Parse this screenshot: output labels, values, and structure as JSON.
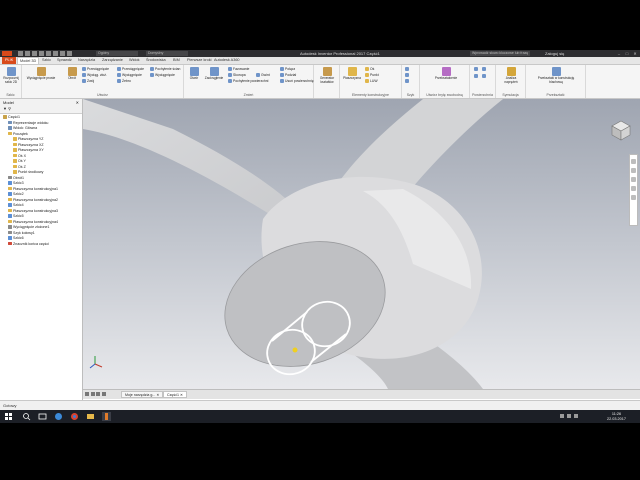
{
  "window": {
    "title": "Autodesk Inventor Professional 2017  Część1",
    "search_placeholder": "Wprowadź słowo kluczowe lub frazę",
    "user": "Zaloguj się",
    "controls": [
      "–",
      "□",
      "✕"
    ]
  },
  "quick_access": {
    "material": "Ogólny",
    "appearance": "Domyślny"
  },
  "tabs": {
    "file": "PLIK",
    "items": [
      "Model 3D",
      "Szkic",
      "Sprawdź",
      "Narzędzia",
      "Zarządzanie",
      "Widok",
      "Środowiska",
      "BIM",
      "Pierwsze kroki",
      "Autodesk A360"
    ]
  },
  "ribbon": {
    "panels": [
      {
        "title": "Szkic",
        "buttons": [
          "Rozpocznij szkic 2D"
        ]
      },
      {
        "title": "Utwórz",
        "buttons": [
          "Wyciągnięcie proste",
          "Obrót"
        ],
        "small": [
          "Przeciągnięcie",
          "Wyciąg. złoż.",
          "Zwój",
          "Przeciągnięcie",
          "Wyciągnięcie",
          "Żebro",
          "Pochylenie ścian",
          "Wyciągnięcie",
          "Powierzchnia",
          "Zaślepka"
        ]
      },
      {
        "title": "Zmień",
        "buttons": [
          "Otwór",
          "Zaokrąglenie"
        ],
        "small": [
          "Fazowanie",
          "Skorupa",
          "Gwint",
          "Pochylenie powierzchni",
          "Połącz",
          "Podział",
          "Usuń",
          "Zamień",
          "Usuń powierzchnię"
        ]
      },
      {
        "title": "Elementy konstrukcyjne",
        "buttons": [
          "Płaszczyzna"
        ],
        "small": [
          "Oś",
          "Punkt",
          "LUW"
        ]
      },
      {
        "title": "Szyk",
        "small": [
          "Szyk",
          "Lustro"
        ]
      },
      {
        "title": "Utwórz bryłę swobodną",
        "buttons": [
          "Przekształcenie"
        ]
      },
      {
        "title": "Powierzchnia",
        "small": [
          "Powierzchnia"
        ]
      },
      {
        "title": "Symulacja",
        "buttons": [
          "Analiza naprężeń"
        ]
      },
      {
        "title": "Przekształć",
        "buttons": [
          "Przekształć w konstrukcję blachową"
        ]
      }
    ],
    "utwórz_dropdown": "Utwórz",
    "zmien_dropdown": "Zmień",
    "gen_ksztaltu": "Generator kształtów",
    "szkic_panel": "Szkic"
  },
  "browser": {
    "title": "Model",
    "close": "✕",
    "tree": [
      {
        "label": "Część1",
        "depth": 0,
        "icon": "#c8a24a"
      },
      {
        "label": "Reprezentacje widoku",
        "depth": 1,
        "icon": "#6f8fb8"
      },
      {
        "label": "Widok: Główna",
        "depth": 1,
        "icon": "#6f8fb8"
      },
      {
        "label": "Początek",
        "depth": 1,
        "icon": "#e0b64a"
      },
      {
        "label": "Płaszczyzna YZ",
        "depth": 2,
        "icon": "#e0b64a"
      },
      {
        "label": "Płaszczyzna XZ",
        "depth": 2,
        "icon": "#e0b64a"
      },
      {
        "label": "Płaszczyzna XY",
        "depth": 2,
        "icon": "#e0b64a"
      },
      {
        "label": "Oś X",
        "depth": 2,
        "icon": "#e0b64a"
      },
      {
        "label": "Oś Y",
        "depth": 2,
        "icon": "#e0b64a"
      },
      {
        "label": "Oś Z",
        "depth": 2,
        "icon": "#e0b64a"
      },
      {
        "label": "Punkt środkowy",
        "depth": 2,
        "icon": "#e0b64a"
      },
      {
        "label": "Obrót1",
        "depth": 1,
        "icon": "#8a8a8a"
      },
      {
        "label": "Szkic3",
        "depth": 1,
        "icon": "#5b8fd6"
      },
      {
        "label": "Płaszczyzna konstrukcyjna1",
        "depth": 1,
        "icon": "#e0b64a"
      },
      {
        "label": "Szkic2",
        "depth": 1,
        "icon": "#5b8fd6"
      },
      {
        "label": "Płaszczyzna konstrukcyjna2",
        "depth": 1,
        "icon": "#e0b64a"
      },
      {
        "label": "Szkic4",
        "depth": 1,
        "icon": "#5b8fd6"
      },
      {
        "label": "Płaszczyzna konstrukcyjna3",
        "depth": 1,
        "icon": "#e0b64a"
      },
      {
        "label": "Szkic5",
        "depth": 1,
        "icon": "#5b8fd6"
      },
      {
        "label": "Płaszczyzna konstrukcyjna4",
        "depth": 1,
        "icon": "#e0b64a"
      },
      {
        "label": "Wyciągnięcie złożone1",
        "depth": 1,
        "icon": "#8a8a8a"
      },
      {
        "label": "Szyk kołowy1",
        "depth": 1,
        "icon": "#8a8a8a"
      },
      {
        "label": "Szkic6",
        "depth": 1,
        "icon": "#5b8fd6"
      },
      {
        "label": "Znacznik końca części",
        "depth": 1,
        "icon": "#d04a3a"
      }
    ]
  },
  "document_tabs": [
    "Moje narzędzia g...",
    "Część1"
  ],
  "doc_tab_close": "✕",
  "status": "Gotowy",
  "taskbar": {
    "time": "11:26",
    "date": "22.03.2017"
  },
  "colors": {
    "accent": "#d84a1b",
    "viewport_top": "#9fa5b1",
    "part": "#d6d7d9",
    "sketch": "#ffffff",
    "point": "#f0d020"
  }
}
